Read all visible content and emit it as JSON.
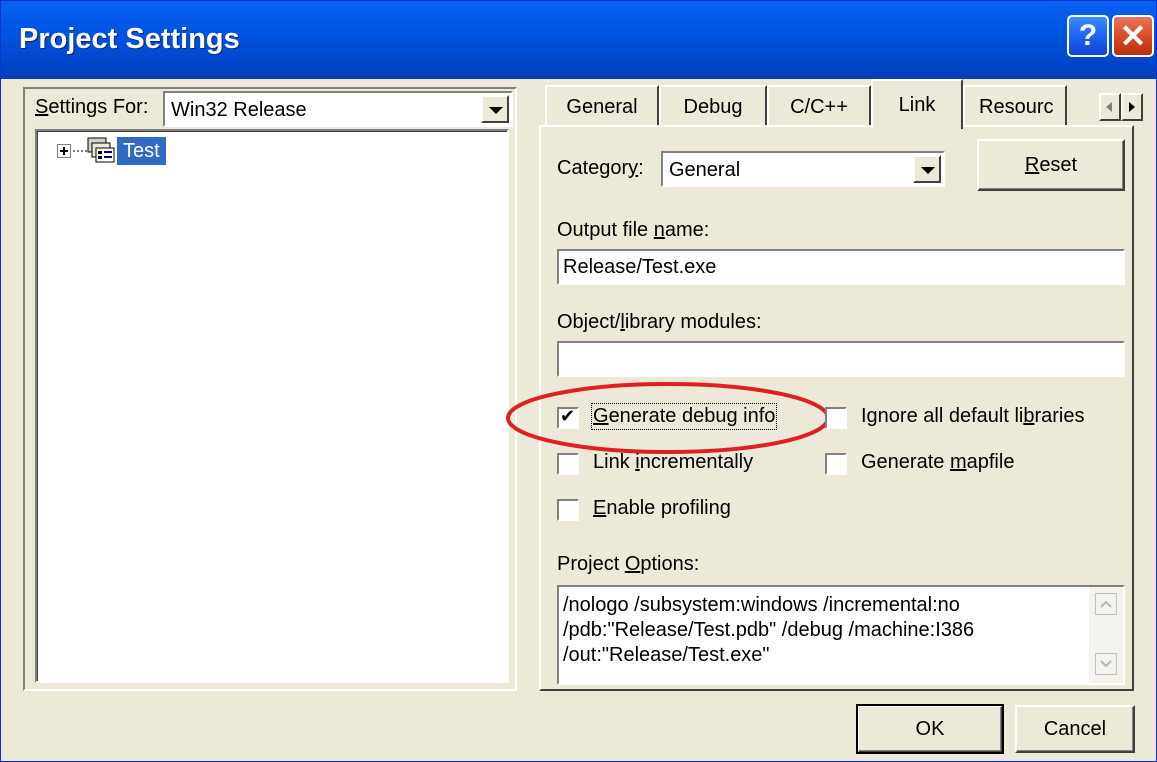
{
  "window": {
    "title": "Project Settings",
    "help_glyph": "?",
    "close_glyph": "✕"
  },
  "left": {
    "settings_for_label": "Settings For:",
    "settings_for_value": "Win32 Release",
    "tree": [
      {
        "label": "Test",
        "icon": "project-icon",
        "expander": "plus",
        "selected": true
      }
    ]
  },
  "tabs": {
    "items": [
      "General",
      "Debug",
      "C/C++",
      "Link",
      "Resourc"
    ],
    "active": "Link",
    "scroll_left": "◂",
    "scroll_right": "▸"
  },
  "link": {
    "category_label": "Category:",
    "category_value": "General",
    "reset_label": "Reset",
    "output_label": "Output file name:",
    "output_value": "Release/Test.exe",
    "modules_label": "Object/library modules:",
    "modules_value": "",
    "options": [
      {
        "label": "Generate debug info",
        "checked": true
      },
      {
        "label": "Ignore all default libraries",
        "checked": false
      },
      {
        "label": "Link incrementally",
        "checked": false
      },
      {
        "label": "Generate mapfile",
        "checked": false
      },
      {
        "label": "Enable profiling",
        "checked": false
      }
    ],
    "project_options_label": "Project Options:",
    "project_options_lines": [
      "/nologo /subsystem:windows /incremental:no",
      "/pdb:\"Release/Test.pdb\" /debug /machine:I386",
      "/out:\"Release/Test.exe\""
    ]
  },
  "buttons": {
    "ok": "OK",
    "cancel": "Cancel"
  },
  "colors": {
    "titlebar": "#0054e3",
    "dialog_bg": "#ece9d8",
    "selection": "#316ac5",
    "highlight_circle": "#e02020"
  }
}
